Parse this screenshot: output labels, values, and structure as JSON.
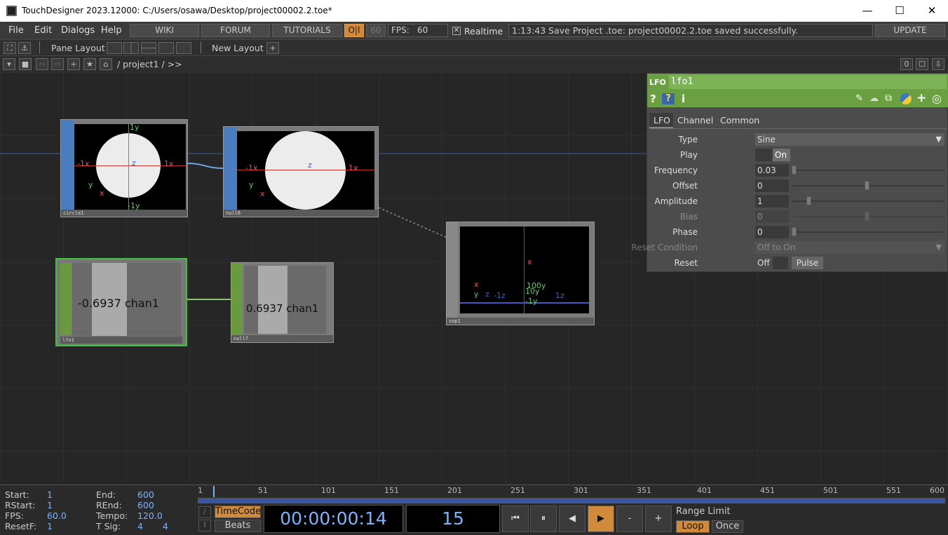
{
  "titlebar": {
    "title": "TouchDesigner 2023.12000: C:/Users/osawa/Desktop/project00002.2.toe*",
    "minimize": "—",
    "maximize": "☐",
    "close": "✕"
  },
  "menubar": {
    "menus": [
      "File",
      "Edit",
      "Dialogs",
      "Help"
    ],
    "links": [
      "WIKI",
      "FORUM",
      "TUTORIALS"
    ],
    "oi": "O|I",
    "fps_box": "60",
    "fps_label": "FPS:",
    "fps_value": "60",
    "realtime_check": "✕",
    "realtime_label": "Realtime",
    "status": "1:13:43 Save Project .toe: project00002.2.toe saved successfully.",
    "update": "UPDATE"
  },
  "toolbar1": {
    "pane_layout": "Pane Layout",
    "new_layout": "New Layout",
    "plus": "+"
  },
  "toolbar2": {
    "path": "/ project1 / >>",
    "counter": "0"
  },
  "nodes": {
    "circle1": {
      "label": "circle1",
      "top_y": "1y",
      "bottom_y": "-1y",
      "left_x": "-1x",
      "right_x": "1x",
      "z": "z",
      "axis_y": "y",
      "axis_x": "x"
    },
    "null6": {
      "label": "null6",
      "left_x": "-1x",
      "right_x": "1x",
      "z": "z",
      "axis_y": "y",
      "axis_x": "x"
    },
    "lfo1": {
      "label": "lfo1",
      "value": "-0.6937 chan1"
    },
    "null7": {
      "label": "null7",
      "value": "0.6937 chan1"
    },
    "sop1": {
      "label": "sop1",
      "x": "x",
      "y100": "100y",
      "y10": "10y",
      "y": "-1y",
      "nz": "-1z",
      "z": "1z",
      "axx": "x",
      "ay": "y",
      "az": "z"
    }
  },
  "params": {
    "type_label": "LFO",
    "name": "lfo1",
    "tabs": [
      "LFO",
      "Channel",
      "Common"
    ],
    "rows": [
      {
        "label": "Type",
        "value": "Sine"
      },
      {
        "label": "Play",
        "value": "On"
      },
      {
        "label": "Frequency",
        "value": "0.03"
      },
      {
        "label": "Offset",
        "value": "0"
      },
      {
        "label": "Amplitude",
        "value": "1"
      },
      {
        "label": "Bias",
        "value": "0"
      },
      {
        "label": "Phase",
        "value": "0"
      },
      {
        "label": "Reset Condition",
        "value": "Off to On"
      },
      {
        "label": "Reset",
        "value": "Off",
        "pulse": "Pulse"
      }
    ]
  },
  "timeline": {
    "start_label": "Start:",
    "start": "1",
    "end_label": "End:",
    "end": "600",
    "rstart_label": "RStart:",
    "rstart": "1",
    "rend_label": "REnd:",
    "rend": "600",
    "fps_label": "FPS:",
    "fps": "60.0",
    "tempo_label": "Tempo:",
    "tempo": "120.0",
    "resetf_label": "ResetF:",
    "resetf": "1",
    "tsig_label": "T Sig:",
    "tsig1": "4",
    "tsig2": "4",
    "ticks": [
      "1",
      "51",
      "101",
      "151",
      "201",
      "251",
      "301",
      "351",
      "401",
      "451",
      "501",
      "551",
      "600"
    ],
    "timecode_btn": "TimeCode",
    "beats_btn": "Beats",
    "timecode": "00:00:00:14",
    "frame": "15",
    "range_limit": "Range Limit",
    "loop": "Loop",
    "once": "Once",
    "minus": "-",
    "plus": "+"
  }
}
